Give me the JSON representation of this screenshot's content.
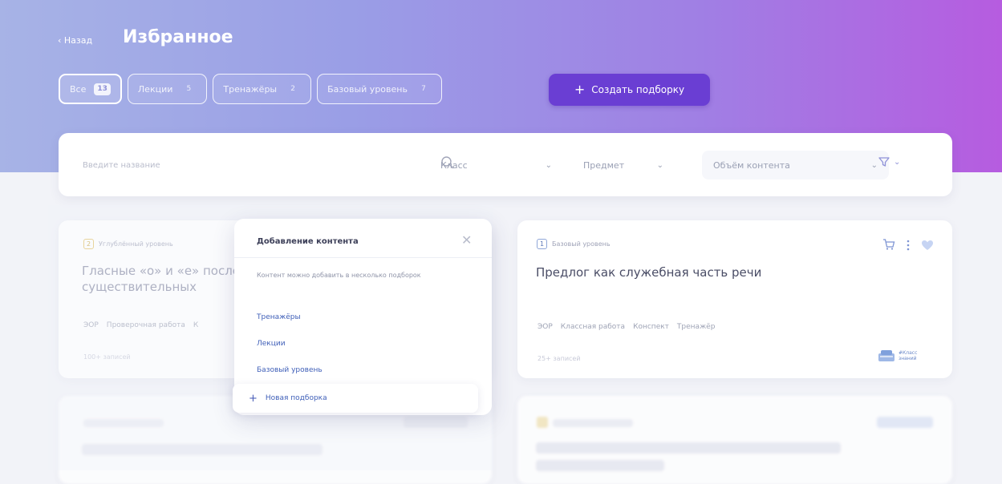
{
  "header": {
    "back_label": "‹ Назад",
    "title": "Избранное",
    "tabs": [
      {
        "label": "Все",
        "count": "13"
      },
      {
        "label": "Лекции",
        "count": "5"
      },
      {
        "label": "Тренажёры",
        "count": "2"
      },
      {
        "label": "Базовый уровень",
        "count": "7"
      }
    ],
    "create_label": "Создать подборку",
    "create_icon": "plus-icon"
  },
  "filters": {
    "search_placeholder": "Введите название",
    "class_label": "Класс",
    "subject_label": "Предмет",
    "volume_label": "Объём контента"
  },
  "cards": [
    {
      "level_num": "2",
      "level": "Углублённый уровень",
      "title_line1": "Гласные «о» и «е» после ш",
      "title_line2": "существительных",
      "tags": [
        "ЭОР",
        "Проверочная работа",
        "К"
      ],
      "records": "100+ записей"
    },
    {
      "level_num": "1",
      "level": "Базовый уровень",
      "title_line1": "Предлог как служебная часть речи",
      "tags": [
        "ЭОР",
        "Классная работа",
        "Конспект",
        "Тренажёр"
      ],
      "records": "25+ записей",
      "logo_line1": "#Класс",
      "logo_line2": "знаний"
    }
  ],
  "popup": {
    "title": "Добавление контента",
    "description": "Контент можно добавить в несколько подборок",
    "items": [
      "Тренажёры",
      "Лекции",
      "Базовый уровень"
    ],
    "new_label": "Новая подборка"
  },
  "colors": {
    "accent": "#6a3ed3",
    "link": "#3f5fb8",
    "level1": "#8fa6d8",
    "level2": "#e4c36a"
  }
}
